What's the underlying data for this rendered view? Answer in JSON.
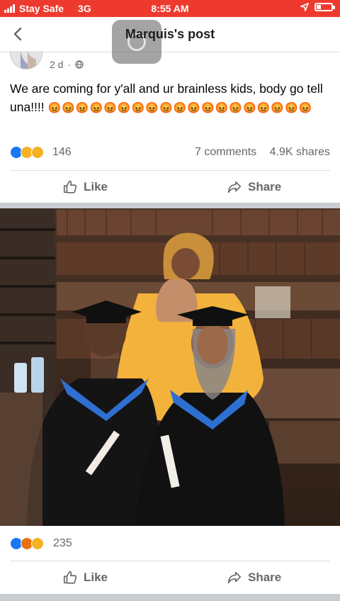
{
  "status_bar": {
    "carrier": "Stay Safe",
    "network": "3G",
    "time": "8:55 AM"
  },
  "nav": {
    "title": "Marquis's post",
    "back_icon": "chevron-left-icon"
  },
  "post": {
    "author_name": "",
    "age": "2 d",
    "visibility_icon": "globe-icon",
    "text": "We are coming for y'all and ur brainless kids, body go tell una!!!!",
    "emojis": "😡😡😡😡😡😡😡😡😡😡😡😡😡😡😡😡😡😡😡",
    "reactions": {
      "icons": [
        "like",
        "sad",
        "haha"
      ],
      "count": "146"
    },
    "comments": "7 comments",
    "shares": "4.9K shares",
    "like_label": "Like",
    "share_label": "Share"
  },
  "photo": {
    "description": "",
    "reactions": {
      "icons": [
        "like",
        "angry",
        "sad"
      ],
      "count": "235"
    },
    "like_label": "Like",
    "share_label": "Share"
  },
  "colors": {
    "status_bar": "#ee3a2e",
    "like_blue": "#1877f2",
    "muted_text": "#65676b"
  }
}
